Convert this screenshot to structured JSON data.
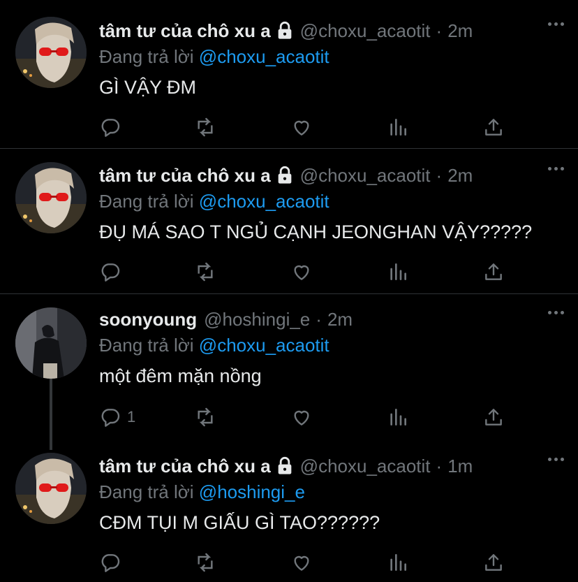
{
  "colors": {
    "background": "#000000",
    "divider": "#2f3336",
    "secondary": "#71767b",
    "link": "#1d9bf0",
    "primary": "#e7e9ea"
  },
  "tweets": [
    {
      "name": "tâm tư của chô xu a",
      "locked": true,
      "handle": "@choxu_acaotit",
      "separator": "·",
      "time": "2m",
      "replying_prefix": "Đang trả lời",
      "replying_to": "@choxu_acaotit",
      "text": "GÌ VẬY ĐM",
      "reply_count": "",
      "avatar": "avatar-red-glasses"
    },
    {
      "name": "tâm tư của chô xu a",
      "locked": true,
      "handle": "@choxu_acaotit",
      "separator": "·",
      "time": "2m",
      "replying_prefix": "Đang trả lời",
      "replying_to": "@choxu_acaotit",
      "text": "ĐỤ MÁ SAO T NGỦ CẠNH JEONGHAN VẬY?????",
      "reply_count": "",
      "avatar": "avatar-red-glasses"
    },
    {
      "name": "soonyoung",
      "locked": false,
      "handle": "@hoshingi_e",
      "separator": "·",
      "time": "2m",
      "replying_prefix": "Đang trả lời",
      "replying_to": "@choxu_acaotit",
      "text": "một đêm mặn nồng",
      "reply_count": "1",
      "avatar": "avatar-dark-figure"
    },
    {
      "name": "tâm tư của chô xu a",
      "locked": true,
      "handle": "@choxu_acaotit",
      "separator": "·",
      "time": "1m",
      "replying_prefix": "Đang trả lời",
      "replying_to": "@hoshingi_e",
      "text": "CĐM TỤI M GIẤU GÌ TAO??????",
      "reply_count": "",
      "avatar": "avatar-red-glasses"
    }
  ],
  "icons": {
    "reply": "reply-icon",
    "retweet": "retweet-icon",
    "like": "heart-icon",
    "views": "views-icon",
    "share": "share-icon",
    "more": "more-icon",
    "lock": "lock-icon"
  }
}
